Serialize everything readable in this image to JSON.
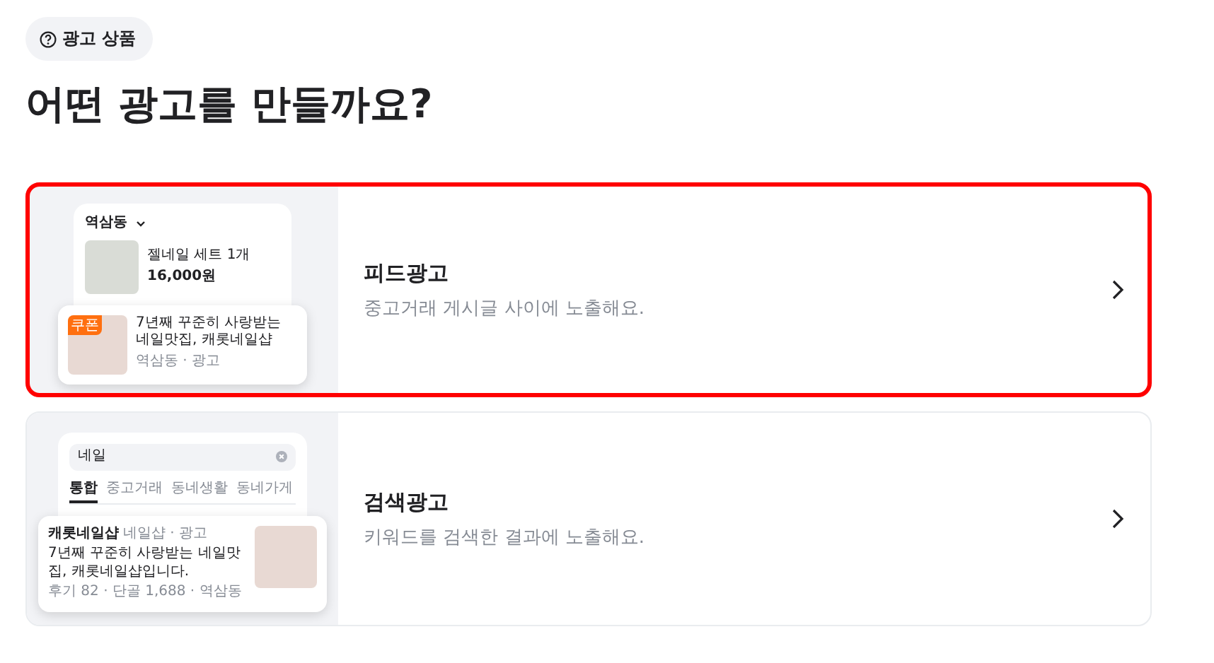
{
  "header": {
    "badge": "광고 상품",
    "title": "어떤 광고를 만들까요?"
  },
  "ad_types": [
    {
      "kind": "feed",
      "selected": true,
      "title": "피드광고",
      "description": "중고거래 게시글 사이에 노출해요.",
      "preview": {
        "location": "역삼동",
        "item": {
          "title": "젤네일 세트 1개",
          "price": "16,000원"
        },
        "ad": {
          "badge": "쿠폰",
          "text": "7년째 꾸준히 사랑받는 네일맛집, 캐롯네일샵",
          "meta": "역삼동 · 광고"
        }
      }
    },
    {
      "kind": "search",
      "selected": false,
      "title": "검색광고",
      "description": "키워드를 검색한 결과에 노출해요.",
      "preview": {
        "query": "네일",
        "tabs": [
          {
            "label": "통합",
            "selected": true
          },
          {
            "label": "중고거래",
            "selected": false
          },
          {
            "label": "동네생활",
            "selected": false
          },
          {
            "label": "동네가게",
            "selected": false
          }
        ],
        "ad": {
          "name": "캐롯네일샵",
          "meta": "네일샵 · 광고",
          "text": "7년째 꾸준히 사랑받는 네일맛집, 캐롯네일샵입니다.",
          "stats": "후기 82 · 단골 1,688 · 역삼동"
        }
      }
    }
  ]
}
